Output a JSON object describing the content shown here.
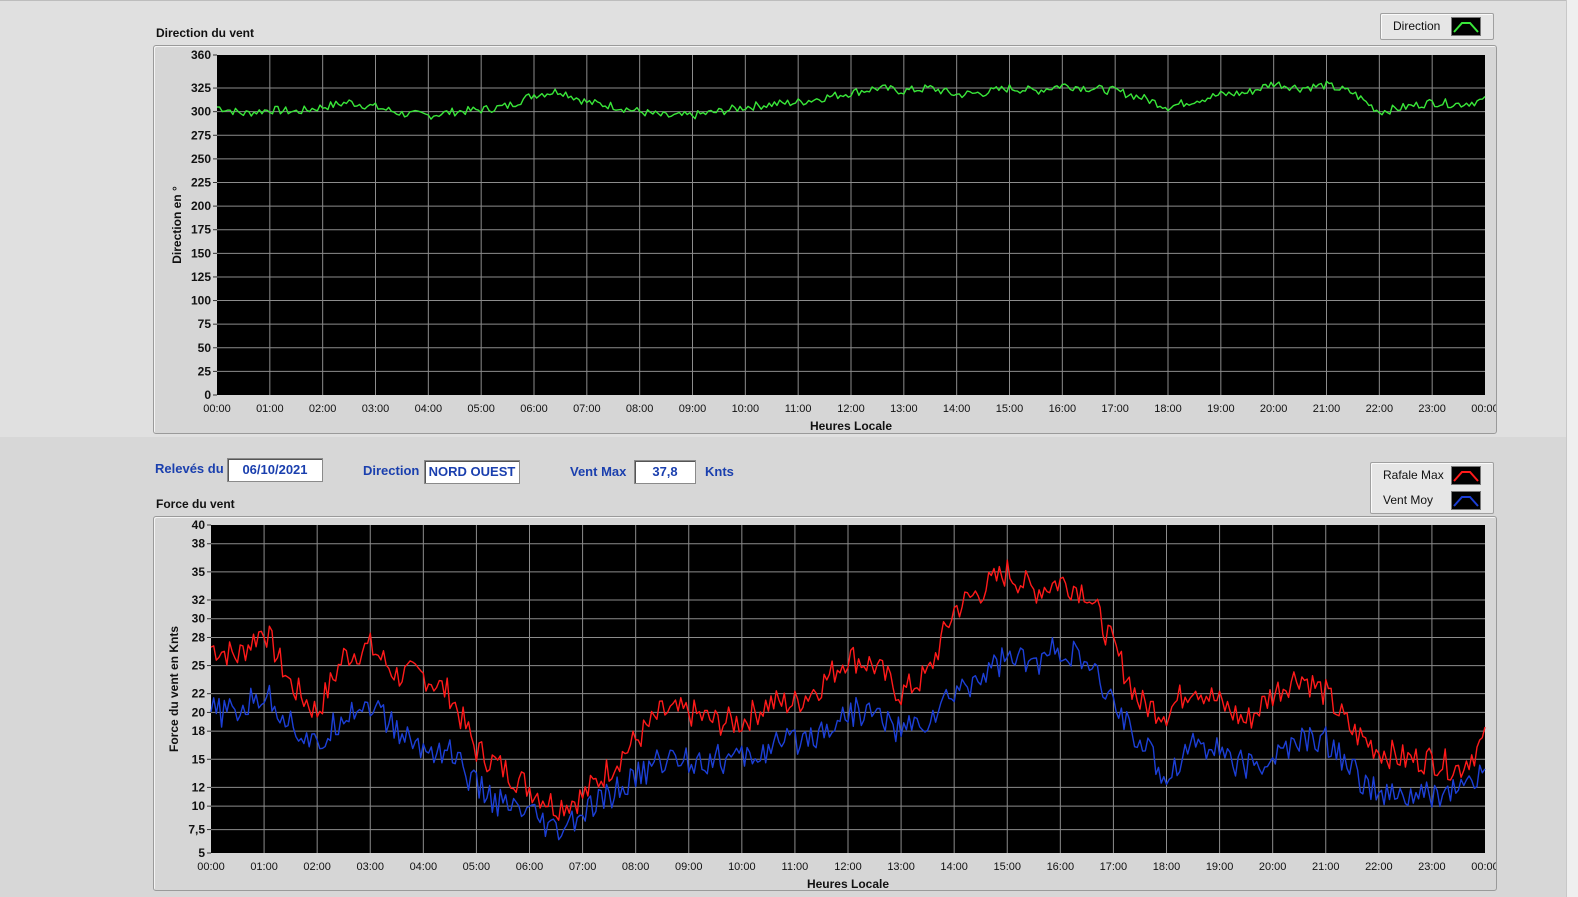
{
  "direction_chart": {
    "section_title": "Direction du vent",
    "legend": {
      "label": "Direction",
      "color": "#39e639"
    },
    "xlabel": "Heures Locale",
    "ylabel": "Direction en °"
  },
  "info": {
    "releves_label": "Relevés du",
    "date_value": "06/10/2021",
    "direction_label": "Direction",
    "direction_value": "NORD OUEST",
    "vent_max_label": "Vent Max",
    "vent_max_value": "37,8",
    "unit_label": "Knts"
  },
  "force_chart": {
    "section_title": "Force du vent",
    "legend": [
      {
        "label": "Rafale Max",
        "color": "#ff1a1a"
      },
      {
        "label": "Vent Moy",
        "color": "#1c3fd6"
      }
    ],
    "xlabel": "Heures Locale",
    "ylabel": "Force du vent en Knts"
  },
  "chart_data": [
    {
      "type": "line",
      "title": "Direction du vent",
      "xlabel": "Heures Locale",
      "ylabel": "Direction en °",
      "x_ticks": [
        "00:00",
        "01:00",
        "02:00",
        "03:00",
        "04:00",
        "05:00",
        "06:00",
        "07:00",
        "08:00",
        "09:00",
        "10:00",
        "11:00",
        "12:00",
        "13:00",
        "14:00",
        "15:00",
        "16:00",
        "17:00",
        "18:00",
        "19:00",
        "20:00",
        "21:00",
        "22:00",
        "23:00",
        "00:00"
      ],
      "y_ticks": [
        "0",
        "25",
        "50",
        "75",
        "100",
        "125",
        "150",
        "175",
        "200",
        "225",
        "250",
        "275",
        "300",
        "325",
        "360"
      ],
      "ylim": [
        0,
        360
      ],
      "grid": true,
      "legend_position": "top-right",
      "series": [
        {
          "name": "Direction",
          "color": "#39e639",
          "x": [
            0,
            0.5,
            1,
            1.5,
            2,
            2.5,
            3,
            3.5,
            4,
            4.5,
            5,
            5.5,
            6,
            6.5,
            7,
            7.5,
            8,
            8.5,
            9,
            9.5,
            10,
            10.5,
            11,
            11.5,
            12,
            12.5,
            13,
            13.5,
            14,
            14.5,
            15,
            15.5,
            16,
            16.5,
            17,
            17.5,
            18,
            18.5,
            19,
            19.5,
            20,
            20.5,
            21,
            21.5,
            22,
            22.5,
            23,
            23.5,
            24
          ],
          "values": [
            305,
            298,
            302,
            300,
            305,
            310,
            305,
            298,
            296,
            300,
            302,
            306,
            318,
            322,
            310,
            306,
            300,
            295,
            296,
            300,
            305,
            308,
            310,
            315,
            320,
            325,
            322,
            325,
            318,
            320,
            325,
            322,
            328,
            325,
            322,
            315,
            305,
            312,
            318,
            320,
            330,
            325,
            328,
            320,
            300,
            305,
            310,
            308,
            312
          ]
        }
      ]
    },
    {
      "type": "line",
      "title": "Force du vent",
      "xlabel": "Heures Locale",
      "ylabel": "Force du vent en Knts",
      "x_ticks": [
        "00:00",
        "01:00",
        "02:00",
        "03:00",
        "04:00",
        "05:00",
        "06:00",
        "07:00",
        "08:00",
        "09:00",
        "10:00",
        "11:00",
        "12:00",
        "13:00",
        "14:00",
        "15:00",
        "16:00",
        "17:00",
        "18:00",
        "19:00",
        "20:00",
        "21:00",
        "22:00",
        "23:00",
        "00:00"
      ],
      "y_ticks": [
        "5",
        "7,5",
        "10",
        "12",
        "15",
        "18",
        "20",
        "22",
        "25",
        "28",
        "30",
        "32",
        "35",
        "38",
        "40"
      ],
      "ylim": [
        5,
        40
      ],
      "grid": true,
      "legend_position": "top-right",
      "series": [
        {
          "name": "Rafale Max",
          "color": "#ff1a1a",
          "x": [
            0,
            0.5,
            1,
            1.5,
            2,
            2.5,
            3,
            3.5,
            4,
            4.5,
            5,
            5.5,
            6,
            6.5,
            7,
            7.5,
            8,
            8.5,
            9,
            9.5,
            10,
            10.5,
            11,
            11.5,
            12,
            12.5,
            13,
            13.5,
            14,
            14.5,
            15,
            15.5,
            16,
            16.5,
            17,
            17.5,
            18,
            18.5,
            19,
            19.5,
            20,
            20.5,
            21,
            21.5,
            22,
            22.5,
            23,
            23.5,
            24
          ],
          "values": [
            27,
            26,
            29,
            23,
            20,
            26,
            27,
            24,
            24,
            22,
            16,
            14,
            12,
            10,
            11,
            14,
            17,
            20,
            20,
            19,
            19,
            21,
            21,
            23,
            26,
            25,
            22,
            24,
            31,
            33,
            35,
            33,
            34,
            33,
            27,
            21,
            20,
            23,
            21,
            19,
            22,
            24,
            22,
            18,
            16,
            15,
            15,
            14,
            17
          ]
        },
        {
          "name": "Vent Moy",
          "color": "#1c3fd6",
          "x": [
            0,
            0.5,
            1,
            1.5,
            2,
            2.5,
            3,
            3.5,
            4,
            4.5,
            5,
            5.5,
            6,
            6.5,
            7,
            7.5,
            8,
            8.5,
            9,
            9.5,
            10,
            10.5,
            11,
            11.5,
            12,
            12.5,
            13,
            13.5,
            14,
            14.5,
            15,
            15.5,
            16,
            16.5,
            17,
            17.5,
            18,
            18.5,
            19,
            19.5,
            20,
            20.5,
            21,
            21.5,
            22,
            22.5,
            23,
            23.5,
            24
          ],
          "values": [
            20,
            20,
            22,
            19,
            16,
            20,
            21,
            18,
            16,
            16,
            12,
            10,
            9,
            7,
            9,
            11,
            13,
            15,
            15,
            15,
            15,
            16,
            17,
            18,
            20,
            20,
            18,
            19,
            22,
            24,
            26,
            25,
            27,
            25,
            21,
            17,
            13,
            17,
            16,
            14,
            15,
            17,
            17,
            14,
            11,
            11,
            11,
            12,
            13
          ]
        }
      ]
    }
  ]
}
